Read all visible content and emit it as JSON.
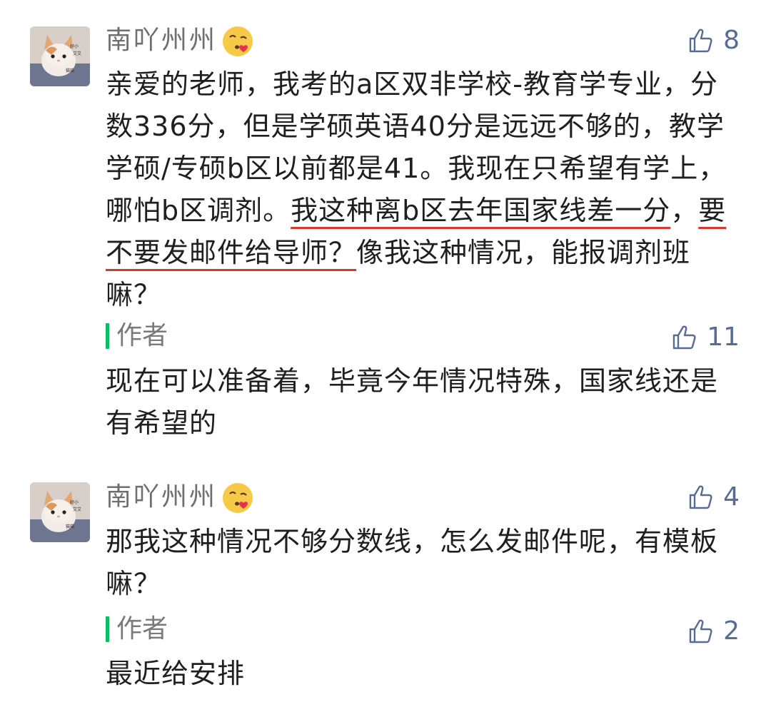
{
  "comments": [
    {
      "username": "南吖州州",
      "user_emoji": "kissing-heart-emoji",
      "likes": "8",
      "text_before": "亲爱的老师，我考的a区双非学校-教育学专业，分数336分，但是学硕英语40分是远远不够的，教学学硕/专硕b区以前都是41。我现在只希望有学上，哪怕b区调剂。",
      "text_hl1": "我这种离b区去年国家线差一分",
      "text_mid": "，",
      "text_hl2": "要不要发邮件给导师？",
      "text_after": "像我这种情况，能报调剂班嘛？",
      "reply": {
        "label": "作者",
        "likes": "11",
        "text": "现在可以准备着，毕竟今年情况特殊，国家线还是有希望的"
      }
    },
    {
      "username": "南吖州州",
      "user_emoji": "kissing-heart-emoji",
      "likes": "4",
      "text": "那我这种情况不够分数线，怎么发邮件呢，有模板嘛？",
      "reply": {
        "label": "作者",
        "likes": "2",
        "text": "最近给安排"
      }
    }
  ],
  "colors": {
    "like": "#576b95",
    "author_bar": "#07c160",
    "underline": "#d9392b",
    "username": "#6f6f6f"
  }
}
